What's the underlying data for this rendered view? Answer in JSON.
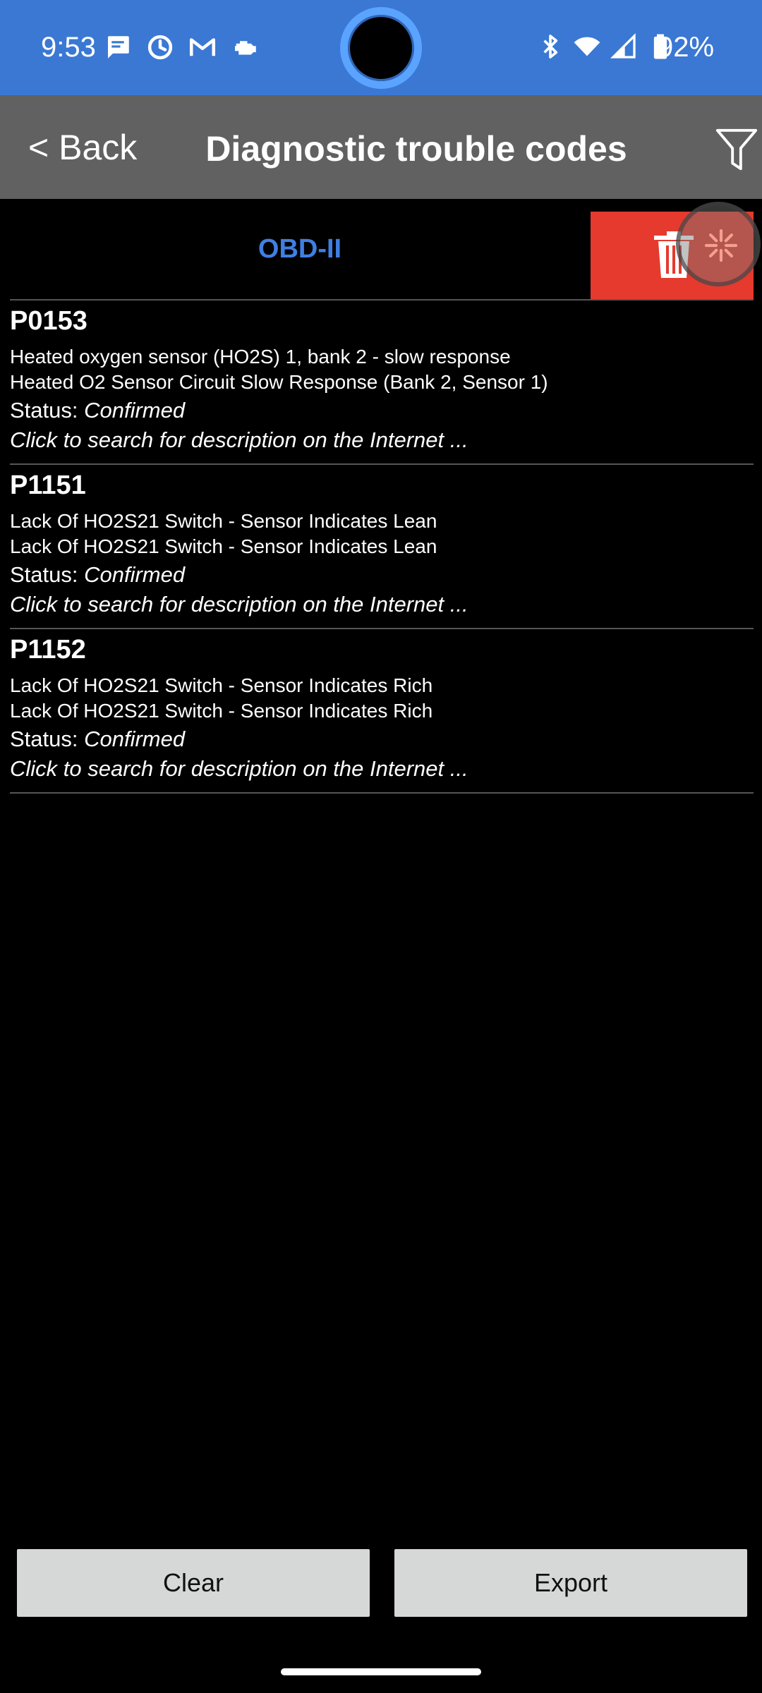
{
  "status_bar": {
    "time": "9:53",
    "battery_percent": "92%",
    "left_icons": [
      "message-icon",
      "sync-icon",
      "gmail-icon",
      "engine-icon"
    ],
    "right_icons": [
      "bluetooth-icon",
      "wifi-icon",
      "signal-icon",
      "battery-icon"
    ],
    "bg_color": "#3a78d4"
  },
  "app_bar": {
    "back_label": "< Back",
    "title": "Diagnostic trouble codes",
    "filter_icon": "filter-icon",
    "bg_color": "#616161"
  },
  "tabs": {
    "obd_label": "OBD-II",
    "accent_color": "#3f7fe3",
    "delete_icon": "trash-icon",
    "delete_color": "#e53a2d"
  },
  "dtc_items": [
    {
      "code": "P0153",
      "desc1": "Heated oxygen sensor (HO2S) 1, bank 2 - slow response",
      "desc2": "Heated O2 Sensor Circuit Slow Response (Bank 2, Sensor 1)",
      "status_label": "Status: ",
      "status_value": "Confirmed",
      "link": "Click to search for description on the Internet ..."
    },
    {
      "code": "P1151",
      "desc1": "Lack Of HO2S21 Switch - Sensor Indicates Lean",
      "desc2": "Lack Of HO2S21 Switch - Sensor Indicates Lean",
      "status_label": "Status: ",
      "status_value": "Confirmed",
      "link": "Click to search for description on the Internet ..."
    },
    {
      "code": "P1152",
      "desc1": "Lack Of HO2S21 Switch - Sensor Indicates Rich",
      "desc2": "Lack Of HO2S21 Switch - Sensor Indicates Rich",
      "status_label": "Status: ",
      "status_value": "Confirmed",
      "link": "Click to search for description on the Internet ..."
    }
  ],
  "buttons": {
    "clear_label": "Clear",
    "export_label": "Export"
  }
}
